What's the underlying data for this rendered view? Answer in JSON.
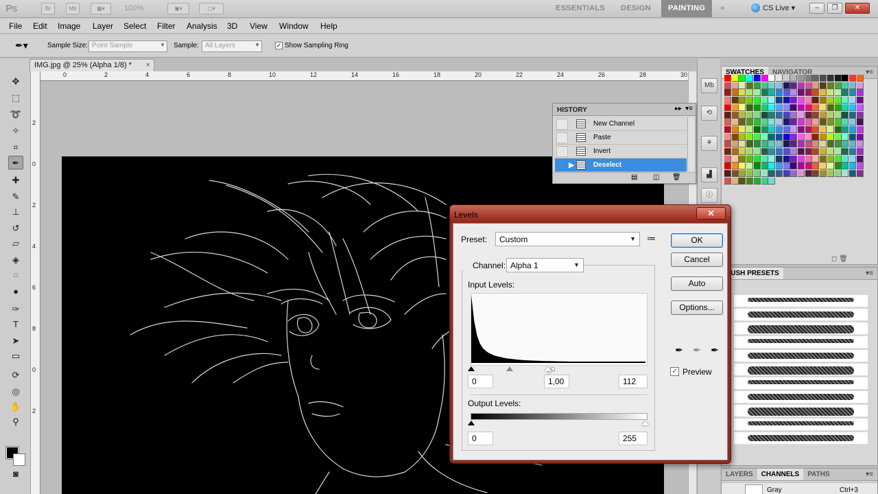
{
  "app": {
    "logo": "Ps",
    "bridge_label": "Br",
    "minibridge_label": "Mb",
    "zoom": "100%",
    "workspaces": [
      "ESSENTIALS",
      "DESIGN",
      "PAINTING"
    ],
    "more": "»",
    "cslive": "CS Live",
    "window_buttons": [
      "–",
      "❐",
      "✕"
    ]
  },
  "menu": [
    "File",
    "Edit",
    "Image",
    "Layer",
    "Select",
    "Filter",
    "Analysis",
    "3D",
    "View",
    "Window",
    "Help"
  ],
  "options": {
    "sample_size_label": "Sample Size:",
    "sample_size_value": "Point Sample",
    "sample_label": "Sample:",
    "sample_value": "All Layers",
    "show_ring_label": "Show Sampling Ring",
    "show_ring_checked": "✓"
  },
  "document": {
    "tab_title": "IMG.jpg @ 25% (Alpha 1/8) *",
    "close": "×",
    "ruler_h": [
      "0",
      "2",
      "4",
      "6",
      "8",
      "10",
      "12",
      "14",
      "16",
      "18",
      "20",
      "22",
      "24",
      "26",
      "28",
      "30"
    ],
    "ruler_v": [
      "2",
      "0",
      "2",
      "4",
      "6",
      "8",
      "0",
      "2"
    ]
  },
  "history": {
    "title": "HISTORY",
    "items": [
      {
        "label": "New Channel",
        "selected": false
      },
      {
        "label": "Paste",
        "selected": false
      },
      {
        "label": "Invert",
        "selected": false
      },
      {
        "label": "Deselect",
        "selected": true
      }
    ]
  },
  "panels": {
    "swatches_tab": "SWATCHES",
    "navigator_tab": "NAVIGATOR",
    "brush_presets_tab": "RUSH PRESETS",
    "layers_tab": "LAYERS",
    "channels_tab": "CHANNELS",
    "paths_tab": "PATHS",
    "channel_row_name": "Gray",
    "channel_row_shortcut": "Ctrl+3"
  },
  "levels": {
    "title": "Levels",
    "close": "✕",
    "preset_label": "Preset:",
    "preset_value": "Custom",
    "channel_label": "Channel:",
    "channel_value": "Alpha 1",
    "input_levels_label": "Input Levels:",
    "input_black": "0",
    "input_gamma": "1,00",
    "input_white": "112",
    "output_levels_label": "Output Levels:",
    "output_black": "0",
    "output_white": "255",
    "buttons": {
      "ok": "OK",
      "cancel": "Cancel",
      "auto": "Auto",
      "options": "Options..."
    },
    "preview_label": "Preview",
    "preview_checked": "✓",
    "histogram": [
      100,
      62,
      40,
      28,
      21,
      17,
      14,
      12,
      10,
      9,
      8,
      7,
      6,
      5.5,
      5,
      4.5,
      4,
      3.6,
      3.3,
      3,
      2.8,
      2.6,
      2.4,
      2.2,
      2,
      1.9,
      1.8,
      1.7,
      1.6,
      1.5,
      1.4,
      1.3,
      1.2,
      1.1,
      1.05,
      1,
      0.95,
      0.9,
      0.85,
      0.8,
      0.75,
      0.7,
      0.68,
      0.65,
      0.62,
      0.6,
      0.58,
      0.55,
      0.52,
      0.5,
      0.48,
      0.46,
      0.44,
      0.42,
      0.4,
      0.38,
      0.36,
      0.35,
      0.34,
      0.33
    ]
  },
  "colors": {
    "dialog_title": "#a23526",
    "selection": "#3b8de0",
    "workspace_active": "#8c8c8c"
  }
}
